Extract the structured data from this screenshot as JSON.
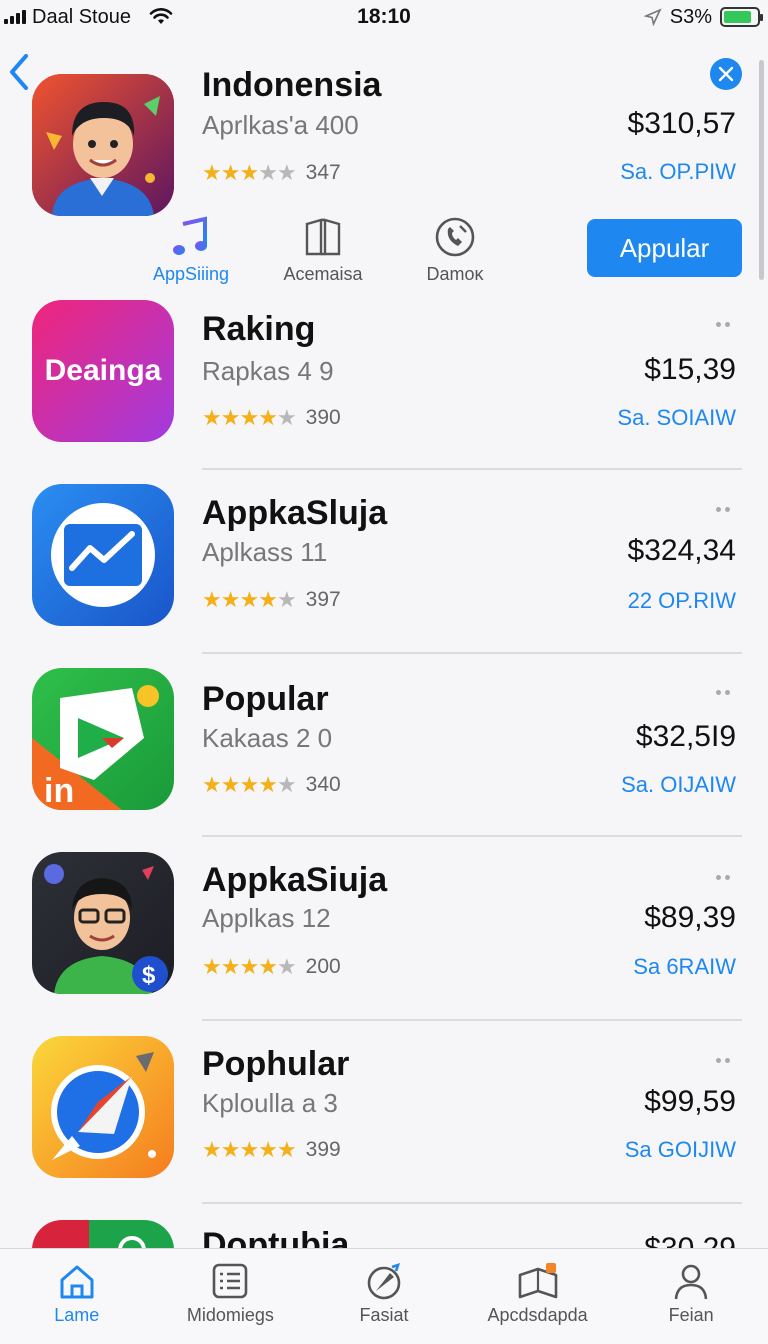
{
  "status_bar": {
    "carrier": "Daal Stoue",
    "time": "18:10",
    "battery_percent": "S3%",
    "battery_level": 0.85
  },
  "header": {
    "title": "Indonensia",
    "subtitle": "Aprlkas'a 400",
    "rating_count": "347",
    "stars": 3.5,
    "price": "$310,57",
    "link": "Sa. OP.PIW",
    "actions": [
      {
        "label": "AppSiiing",
        "icon": "music-note-icon"
      },
      {
        "label": "Acemaisa",
        "icon": "book-icon"
      },
      {
        "label": "Damoĸ",
        "icon": "phone-icon"
      }
    ],
    "primary_button": "Appular"
  },
  "apps": [
    {
      "title": "Raking",
      "subtitle": "Rapkas 4 9",
      "stars": 4,
      "rating_count": "390",
      "price": "$15,39",
      "link": "Sa. SOIAIW",
      "icon_text": "Deainga",
      "icon": "pink-gradient-icon"
    },
    {
      "title": "AppkaSluja",
      "subtitle": "Aplkass 11",
      "stars": 4,
      "rating_count": "397",
      "price": "$324,34",
      "link": "22 OP.RIW",
      "icon": "chart-trend-icon"
    },
    {
      "title": "Popular",
      "subtitle": "Kakaas 2 0",
      "stars": 4,
      "rating_count": "340",
      "price": "$32,5I9",
      "link": "Sa. OIJAIW",
      "icon_text": "in",
      "icon": "play-icon"
    },
    {
      "title": "AppkaSiuja",
      "subtitle": "Applkas 12",
      "stars": 4,
      "rating_count": "200",
      "price": "$89,39",
      "link": "Sa 6RAIW",
      "icon": "avatar-character-icon"
    },
    {
      "title": "Pophular",
      "subtitle": "Kploulla a 3",
      "stars": 5,
      "rating_count": "399",
      "price": "$99,59",
      "link": "Sa GOIJIW",
      "icon": "compass-icon"
    },
    {
      "title": "Doptubia",
      "subtitle": "",
      "stars": 0,
      "rating_count": "",
      "price": "$30,29",
      "link": "",
      "icon": "green-red-icon"
    }
  ],
  "tabs": [
    {
      "label": "Lame",
      "icon": "home-icon",
      "active": true
    },
    {
      "label": "Midomiegs",
      "icon": "list-icon",
      "active": false
    },
    {
      "label": "Fasiat",
      "icon": "rocket-icon",
      "active": false
    },
    {
      "label": "Apcdsdapda",
      "icon": "map-icon",
      "active": false
    },
    {
      "label": "Feian",
      "icon": "person-icon",
      "active": false
    }
  ],
  "colors": {
    "accent": "#1e88f0",
    "star": "#f4b018"
  }
}
